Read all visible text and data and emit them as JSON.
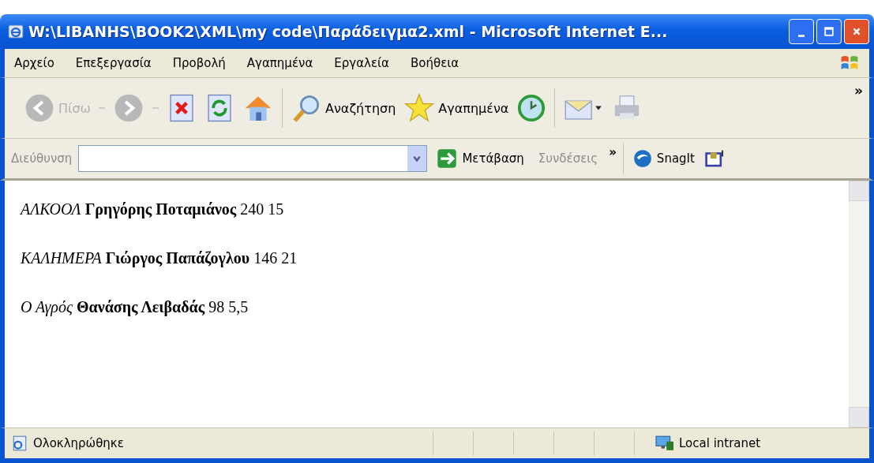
{
  "window": {
    "title": "W:\\LIBANHS\\BOOK2\\XML\\my code\\Παράδειγμα2.xml - Microsoft Internet E..."
  },
  "menu": [
    {
      "label": "Αρχείο"
    },
    {
      "label": "Επεξεργασία"
    },
    {
      "label": "Προβολή"
    },
    {
      "label": "Αγαπημένα"
    },
    {
      "label": "Εργαλεία"
    },
    {
      "label": "Βοήθεια"
    }
  ],
  "toolbar": {
    "back": {
      "label": "Πίσω",
      "disabled": true
    },
    "forward": {
      "disabled": true
    },
    "search": {
      "label": "Αναζήτηση"
    },
    "favorites": {
      "label": "Αγαπημένα"
    },
    "more": "»"
  },
  "address_bar": {
    "label": "Διεύθυνση",
    "go": "Μετάβαση",
    "links": "Συνδέσεις",
    "more": "»",
    "snagit": "SnagIt"
  },
  "content": [
    {
      "text": "*ΑΛΚΟΟΛ* **Γρηγόρης Ποταμιάνος** 240 15"
    },
    {
      "text": "*ΚΑΛΗΜΕΡΑ* **Γιώργος Παπάζογλου** 146 21"
    },
    {
      "text": "*Ο Αγρός* **Θανάσης Λειβαδάς** 98 5,5"
    }
  ],
  "status_bar": {
    "text": "Ολοκληρώθηκε",
    "zone": "Local intranet"
  }
}
